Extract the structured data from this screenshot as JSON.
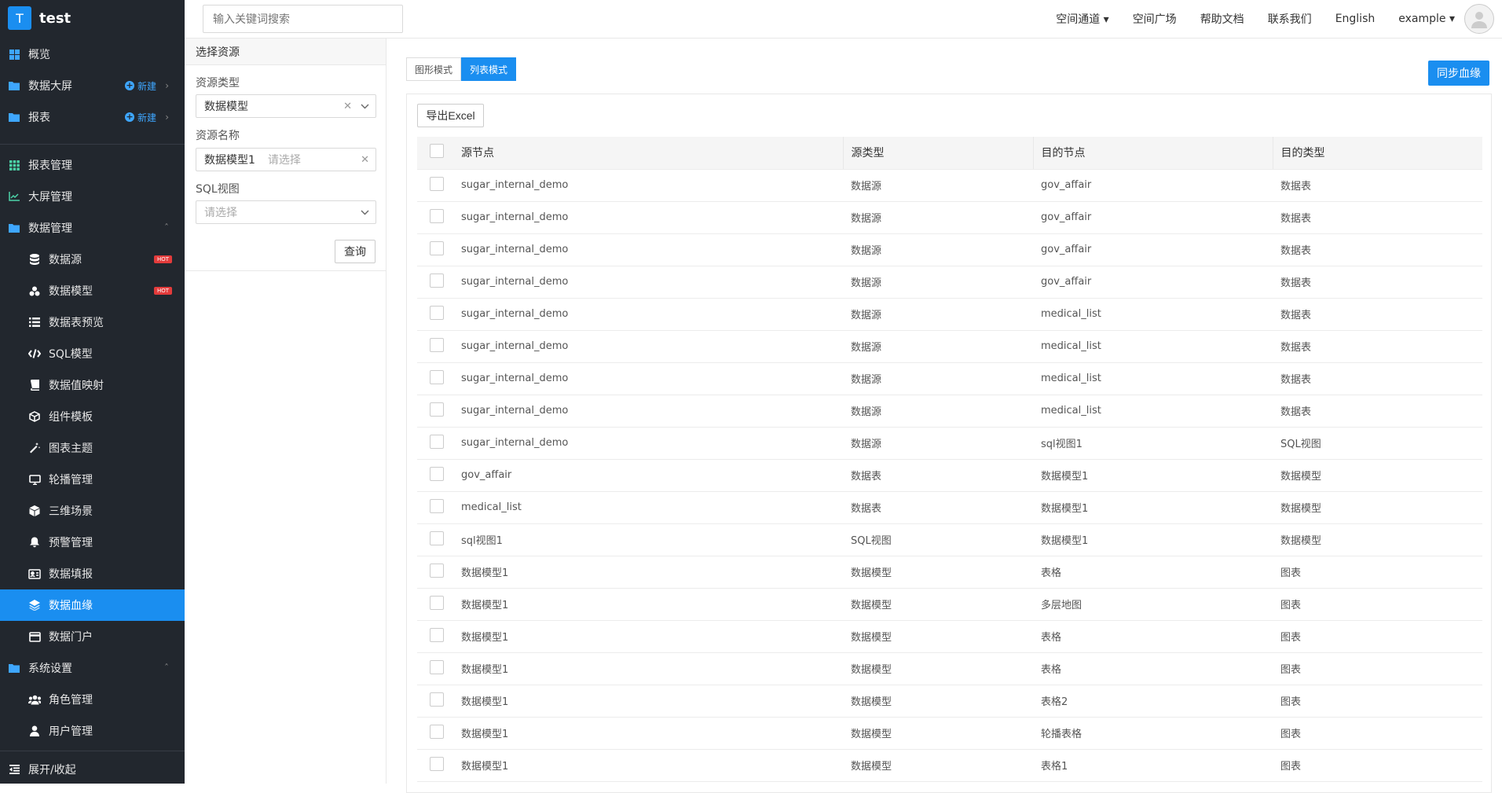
{
  "app": {
    "logo_letter": "T",
    "name": "test"
  },
  "sidebar": {
    "new_label": "新建",
    "items": [
      {
        "label": "概览",
        "icon": "dashboard-icon"
      },
      {
        "label": "数据大屏",
        "icon": "folder-icon"
      },
      {
        "label": "报表",
        "icon": "folder-icon"
      },
      {
        "label": "报表管理",
        "icon": "grid-icon"
      },
      {
        "label": "大屏管理",
        "icon": "chart-icon"
      },
      {
        "label": "数据管理",
        "icon": "folder-icon"
      },
      {
        "label": "数据源",
        "icon": "database-icon",
        "badge": "HOT"
      },
      {
        "label": "数据模型",
        "icon": "model-icon",
        "badge": "HOT"
      },
      {
        "label": "数据表预览",
        "icon": "list-icon"
      },
      {
        "label": "SQL模型",
        "icon": "code-icon"
      },
      {
        "label": "数据值映射",
        "icon": "book-icon"
      },
      {
        "label": "组件模板",
        "icon": "cube-outline-icon"
      },
      {
        "label": "图表主题",
        "icon": "magic-wand-icon"
      },
      {
        "label": "轮播管理",
        "icon": "monitor-icon"
      },
      {
        "label": "三维场景",
        "icon": "cube-icon"
      },
      {
        "label": "预警管理",
        "icon": "bell-icon"
      },
      {
        "label": "数据填报",
        "icon": "id-card-icon"
      },
      {
        "label": "数据血缘",
        "icon": "layers-icon"
      },
      {
        "label": "数据门户",
        "icon": "window-icon"
      },
      {
        "label": "系统设置",
        "icon": "folder-icon"
      },
      {
        "label": "角色管理",
        "icon": "users-icon"
      },
      {
        "label": "用户管理",
        "icon": "user-icon"
      }
    ],
    "collapse_label": "展开/收起"
  },
  "topbar": {
    "search_placeholder": "输入关键词搜索",
    "nav": [
      "空间通道 ▾",
      "空间广场",
      "帮助文档",
      "联系我们",
      "English",
      "example ▾"
    ]
  },
  "filter": {
    "title": "选择资源",
    "resource_type_label": "资源类型",
    "resource_type_value": "数据模型",
    "resource_name_label": "资源名称",
    "resource_name_value": "数据模型1",
    "resource_name_placeholder": "请选择",
    "sql_view_label": "SQL视图",
    "sql_view_placeholder": "请选择",
    "query_label": "查询"
  },
  "main": {
    "mode_graph": "图形模式",
    "mode_list": "列表模式",
    "sync_label": "同步血缘",
    "export_label": "导出Excel",
    "columns": [
      "源节点",
      "源类型",
      "目的节点",
      "目的类型"
    ],
    "rows": [
      [
        "sugar_internal_demo",
        "数据源",
        "gov_affair",
        "数据表"
      ],
      [
        "sugar_internal_demo",
        "数据源",
        "gov_affair",
        "数据表"
      ],
      [
        "sugar_internal_demo",
        "数据源",
        "gov_affair",
        "数据表"
      ],
      [
        "sugar_internal_demo",
        "数据源",
        "gov_affair",
        "数据表"
      ],
      [
        "sugar_internal_demo",
        "数据源",
        "medical_list",
        "数据表"
      ],
      [
        "sugar_internal_demo",
        "数据源",
        "medical_list",
        "数据表"
      ],
      [
        "sugar_internal_demo",
        "数据源",
        "medical_list",
        "数据表"
      ],
      [
        "sugar_internal_demo",
        "数据源",
        "medical_list",
        "数据表"
      ],
      [
        "sugar_internal_demo",
        "数据源",
        "sql视图1",
        "SQL视图"
      ],
      [
        "gov_affair",
        "数据表",
        "数据模型1",
        "数据模型"
      ],
      [
        "medical_list",
        "数据表",
        "数据模型1",
        "数据模型"
      ],
      [
        "sql视图1",
        "SQL视图",
        "数据模型1",
        "数据模型"
      ],
      [
        "数据模型1",
        "数据模型",
        "表格",
        "图表"
      ],
      [
        "数据模型1",
        "数据模型",
        "多层地图",
        "图表"
      ],
      [
        "数据模型1",
        "数据模型",
        "表格",
        "图表"
      ],
      [
        "数据模型1",
        "数据模型",
        "表格",
        "图表"
      ],
      [
        "数据模型1",
        "数据模型",
        "表格2",
        "图表"
      ],
      [
        "数据模型1",
        "数据模型",
        "轮播表格",
        "图表"
      ],
      [
        "数据模型1",
        "数据模型",
        "表格1",
        "图表"
      ]
    ]
  },
  "colors": {
    "accent": "#1a8ef0",
    "sidebar_bg": "#22272e",
    "hot": "#e33b3b"
  }
}
